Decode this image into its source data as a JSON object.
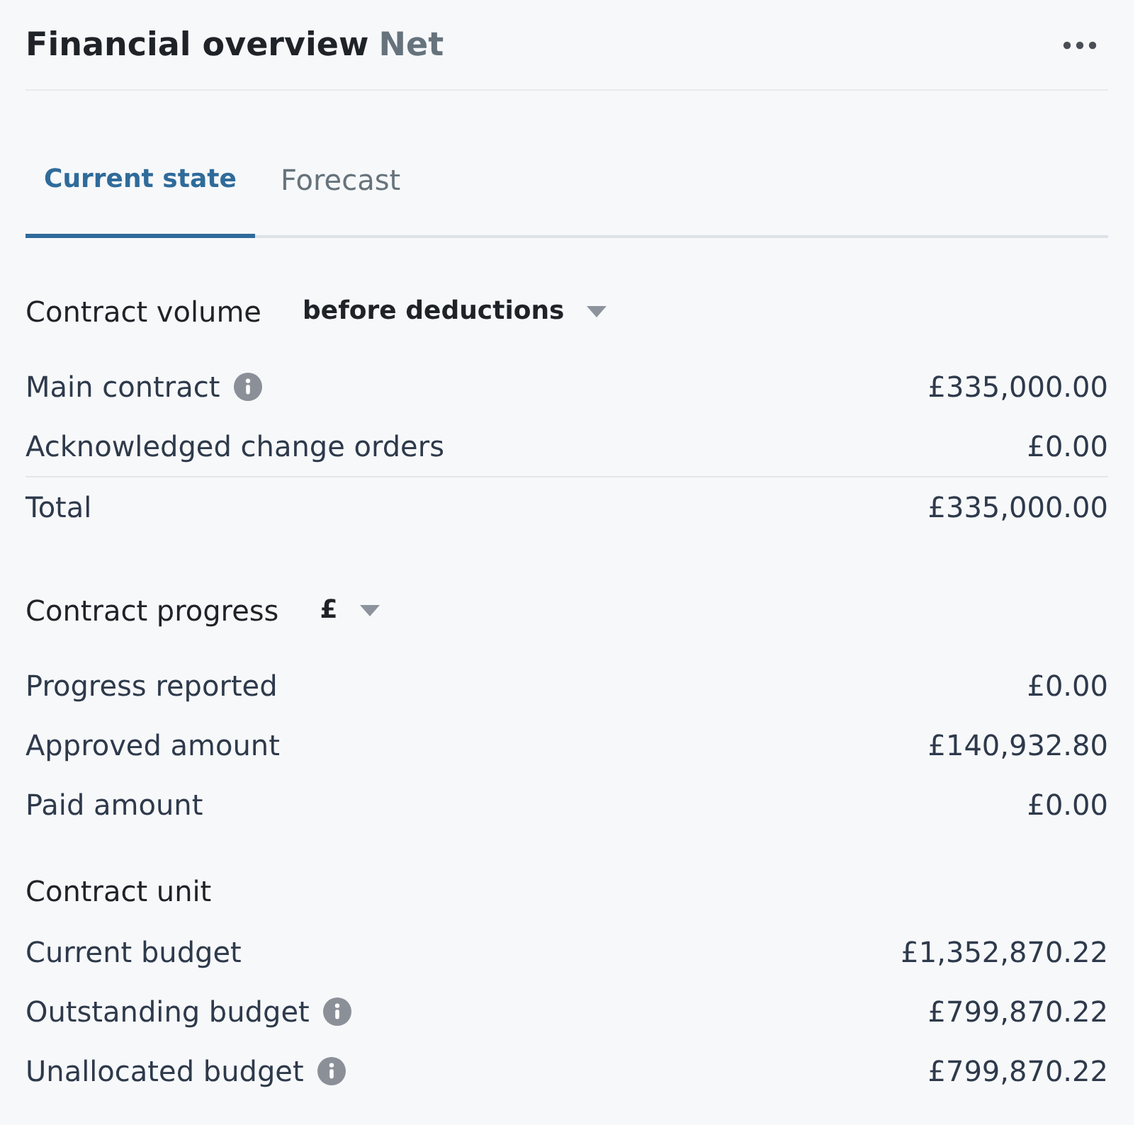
{
  "header": {
    "title": "Financial overview",
    "qualifier": "Net"
  },
  "tabs": [
    {
      "label": "Current state",
      "selected": true
    },
    {
      "label": "Forecast",
      "selected": false
    }
  ],
  "sections": [
    {
      "heading": "Contract volume",
      "dropdown": {
        "value": "before deductions"
      },
      "rows": [
        {
          "kind": "item",
          "label": "Main contract",
          "info": true,
          "value": "£335,000.00"
        },
        {
          "kind": "item",
          "label": "Acknowledged change orders",
          "info": false,
          "value": "£0.00"
        },
        {
          "kind": "total",
          "label": "Total",
          "info": false,
          "value": "£335,000.00"
        }
      ]
    },
    {
      "heading": "Contract progress",
      "dropdown": {
        "value": "£"
      },
      "rows": [
        {
          "kind": "item",
          "label": "Progress reported",
          "info": false,
          "value": "£0.00"
        },
        {
          "kind": "item",
          "label": "Approved amount",
          "info": false,
          "value": "£140,932.80"
        },
        {
          "kind": "item",
          "label": "Paid amount",
          "info": false,
          "value": "£0.00"
        }
      ]
    },
    {
      "heading": "Contract unit",
      "rows": [
        {
          "kind": "item",
          "label": "Current budget",
          "info": false,
          "value": "£1,352,870.22"
        },
        {
          "kind": "item",
          "label": "Outstanding budget",
          "info": true,
          "value": "£799,870.22"
        },
        {
          "kind": "item",
          "label": "Unallocated budget",
          "info": true,
          "value": "£799,870.22"
        }
      ]
    }
  ]
}
